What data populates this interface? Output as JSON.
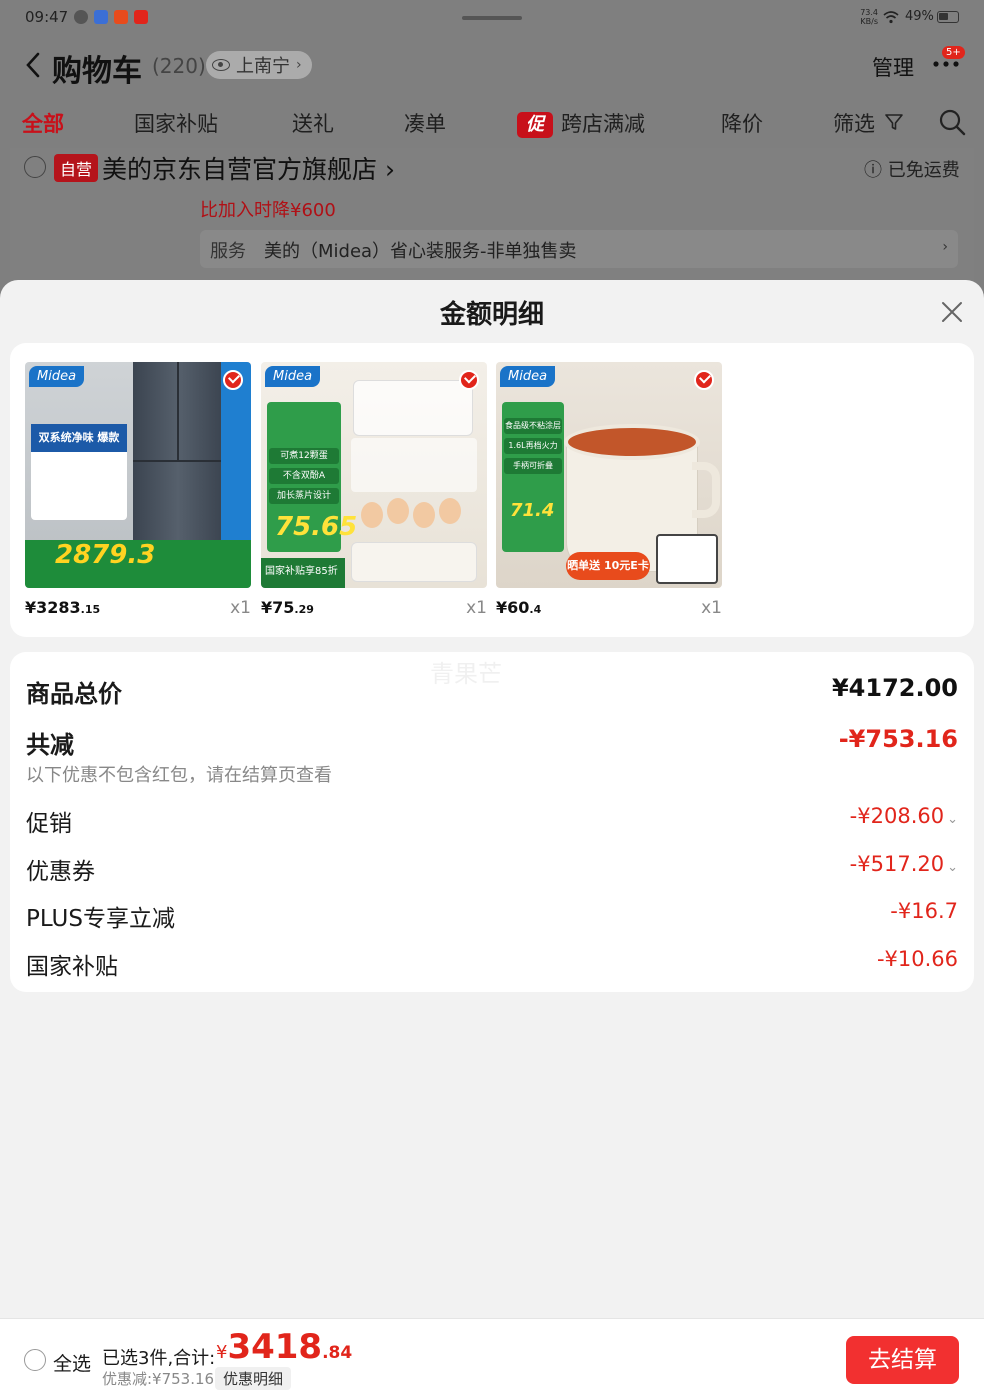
{
  "status_bar": {
    "time": "09:47",
    "net_speed": "73.4\nKB/s",
    "battery": "49%"
  },
  "header": {
    "title": "购物车",
    "count": "(220)",
    "location": "上南宁",
    "manage": "管理",
    "more_badge": "5+"
  },
  "tabs": [
    {
      "label": "全部",
      "active": true
    },
    {
      "label": "国家补贴"
    },
    {
      "label": "送礼"
    },
    {
      "label": "凑单"
    },
    {
      "label": "跨店满减",
      "badge": "促"
    },
    {
      "label": "降价"
    },
    {
      "label": "筛选"
    }
  ],
  "store": {
    "badge": "自营",
    "name": "美的京东自营官方旗舰店 ›",
    "free_shipping": "ⓘ 已免运费",
    "price_drop": "比加入时降¥600",
    "service_label": "服务",
    "service_text": "美的（Midea）省心装服务-非单独售卖",
    "service_chevron": "›"
  },
  "sheet": {
    "title": "金额明细",
    "watermark": "青果芒"
  },
  "products": [
    {
      "brand": "Midea",
      "price_int": "¥3283",
      "price_dec": ".15",
      "qty": "x1",
      "image_price": "2879.3",
      "image_head": "双系统净味 爆款508"
    },
    {
      "brand": "Midea",
      "price_int": "¥75",
      "price_dec": ".29",
      "qty": "x1",
      "image_price": "75.65",
      "pills": [
        "可煮12颗蛋",
        "不含双酚A",
        "加长蒸片设计"
      ],
      "image_foot": "国家补贴享85折"
    },
    {
      "brand": "Midea",
      "price_int": "¥60",
      "price_dec": ".4",
      "qty": "x1",
      "image_price": "71.4",
      "pills": [
        "食品级不粘涂层",
        "1.6L再档火力",
        "手柄可折叠"
      ],
      "tag": "晒单送 10元E卡",
      "fold": "手柄可折叠"
    }
  ],
  "summary": {
    "total_label": "商品总价",
    "total_value": "¥4172.00",
    "reduce_label": "共减",
    "reduce_value": "-¥753.16",
    "note": "以下优惠不包含红包，请在结算页查看",
    "details": [
      {
        "label": "促销",
        "value": "-¥208.60",
        "chevron": "⌄"
      },
      {
        "label": "优惠券",
        "value": "-¥517.20",
        "chevron": "⌄"
      },
      {
        "label": "PLUS专享立减",
        "value": "-¥16.7",
        "chevron": ""
      },
      {
        "label": "国家补贴",
        "value": "-¥10.66",
        "chevron": ""
      }
    ]
  },
  "footer": {
    "select_all": "全选",
    "selected_text": "已选3件,合计:",
    "total_symbol": "¥",
    "total_int": "3418",
    "total_dec": ".84",
    "discount_text": "优惠减:¥753.16",
    "detail_chip": "优惠明细",
    "checkout": "去结算"
  },
  "colors": {
    "accent_red": "#e1251b",
    "checkout_red": "#f23030",
    "brand_blue": "#1a73c8",
    "promo_green": "#2f9d4a"
  }
}
